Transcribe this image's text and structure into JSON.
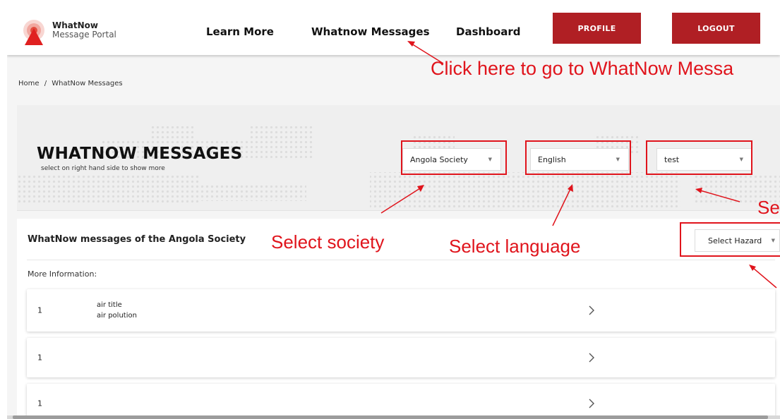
{
  "brand": {
    "name": "WhatNow",
    "subtitle": "Message Portal"
  },
  "nav": {
    "learn_more": "Learn More",
    "messages": "Whatnow Messages",
    "dashboard": "Dashboard",
    "profile": "PROFILE",
    "logout": "LOGOUT"
  },
  "breadcrumb": {
    "home": "Home",
    "separator": "/",
    "current": "WhatNow Messages"
  },
  "hero": {
    "title": "WHATNOW MESSAGES",
    "subtitle": "select on right hand side to show more",
    "society_select": "Angola Society",
    "language_select": "English",
    "third_select": "test"
  },
  "content": {
    "title": "WhatNow messages of the Angola Society",
    "hazard_select": "Select Hazard",
    "more_info": "More Information:",
    "rows": [
      {
        "number": "1",
        "title": "air title",
        "description": "air polution"
      },
      {
        "number": "1",
        "title": "",
        "description": ""
      },
      {
        "number": "1",
        "title": "",
        "description": ""
      }
    ]
  },
  "annotations": {
    "messages_hint": "Click here to go to WhatNow Messa",
    "society_hint": "Select society",
    "language_hint": "Select language",
    "partial_hint": "Se"
  },
  "colors": {
    "brand_red": "#b01f24",
    "annotation_red": "#e0141c"
  },
  "icons": {
    "logo": "alert-beacon-logo",
    "caret": "caret-down-icon",
    "chevron": "chevron-right-icon"
  }
}
